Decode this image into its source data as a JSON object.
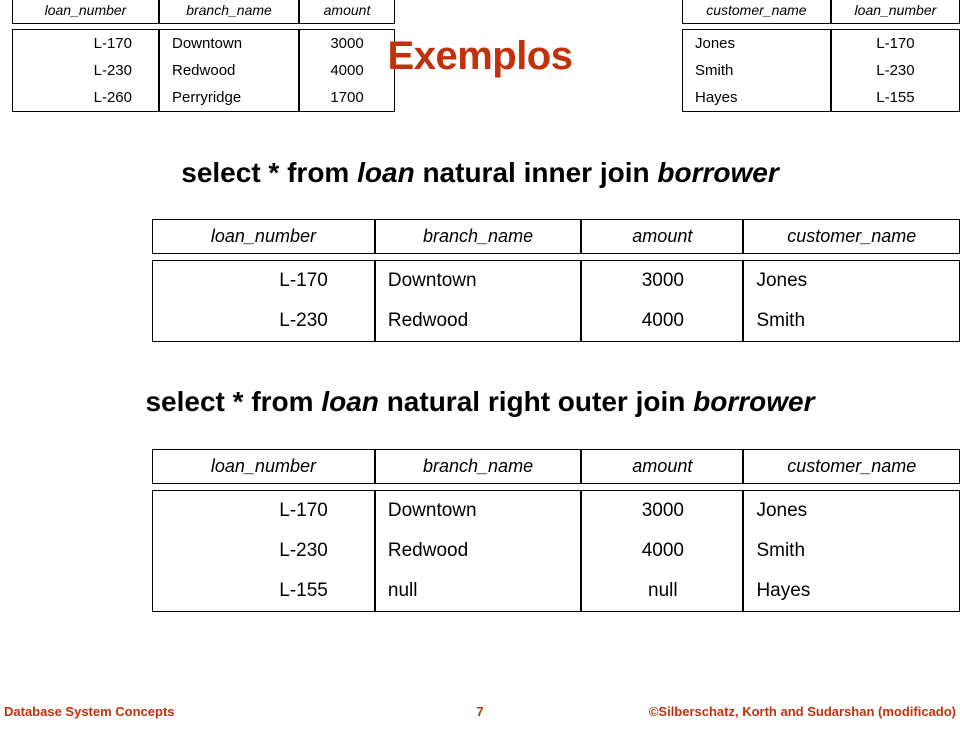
{
  "slide": {
    "title": "Exemplos",
    "accent_color": "#C1320A",
    "page_number": "7"
  },
  "source_tables": {
    "loan": {
      "name": "loan",
      "headers": [
        "loan_number",
        "branch_name",
        "amount"
      ],
      "rows": [
        [
          "L-170",
          "Downtown",
          "3000"
        ],
        [
          "L-230",
          "Redwood",
          "4000"
        ],
        [
          "L-260",
          "Perryridge",
          "1700"
        ]
      ]
    },
    "borrower": {
      "name": "borrower",
      "headers": [
        "customer_name",
        "loan_number"
      ],
      "rows": [
        [
          "Jones",
          "L-170"
        ],
        [
          "Smith",
          "L-230"
        ],
        [
          "Hayes",
          "L-155"
        ]
      ]
    }
  },
  "queries": [
    {
      "id": "inner-join",
      "parts": [
        "select * from ",
        "loan",
        " natural inner join ",
        "borrower"
      ],
      "keyword_1": "select * from",
      "relation_1": "loan",
      "keyword_2": "natural inner join",
      "relation_2": "borrower",
      "full_text": "select * from loan natural inner join borrower",
      "result": {
        "headers": [
          "loan_number",
          "branch_name",
          "amount",
          "customer_name"
        ],
        "rows": [
          [
            "L-170",
            "Downtown",
            "3000",
            "Jones"
          ],
          [
            "L-230",
            "Redwood",
            "4000",
            "Smith"
          ]
        ]
      }
    },
    {
      "id": "right-outer-join",
      "keyword_1": "select * from",
      "relation_1": "loan",
      "keyword_2": "natural right outer join",
      "relation_2": "borrower",
      "full_text": "select * from loan natural right outer join borrower",
      "result": {
        "headers": [
          "loan_number",
          "branch_name",
          "amount",
          "customer_name"
        ],
        "rows": [
          [
            "L-170",
            "Downtown",
            "3000",
            "Jones"
          ],
          [
            "L-230",
            "Redwood",
            "4000",
            "Smith"
          ],
          [
            "L-155",
            "null",
            "null",
            "Hayes"
          ]
        ]
      }
    }
  ],
  "footer": {
    "left": "Database System Concepts",
    "page": "7",
    "right": "©Silberschatz, Korth and Sudarshan (modificado)"
  }
}
